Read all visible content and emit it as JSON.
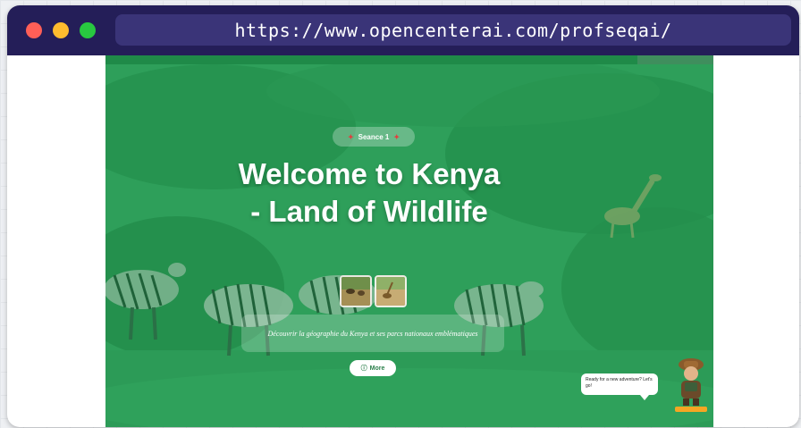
{
  "browser": {
    "url": "https://www.opencenterai.com/profseqai/",
    "controls": [
      "close",
      "minimize",
      "maximize"
    ]
  },
  "colors": {
    "titlebar": "#241e58",
    "overlay_green": "#2a9a56",
    "close": "#ff5f57",
    "minimize": "#febc2e",
    "maximize": "#28c840"
  },
  "progress": {
    "fraction": 0.875
  },
  "badge": {
    "label": "Seance 1",
    "icon_left": "flag-icon",
    "icon_right": "flag-icon"
  },
  "hero": {
    "title": "Welcome to Kenya - Land of Wildlife"
  },
  "thumbnails": [
    "savanna-thumbnail",
    "giraffe-thumbnail"
  ],
  "description": "Découvrir la géographie du Kenya et ses parcs nationaux emblématiques",
  "more_button": {
    "label": "More",
    "icon": "info-icon"
  },
  "assistant": {
    "bubble_text": "Ready for a new adventure? Let's go!"
  }
}
